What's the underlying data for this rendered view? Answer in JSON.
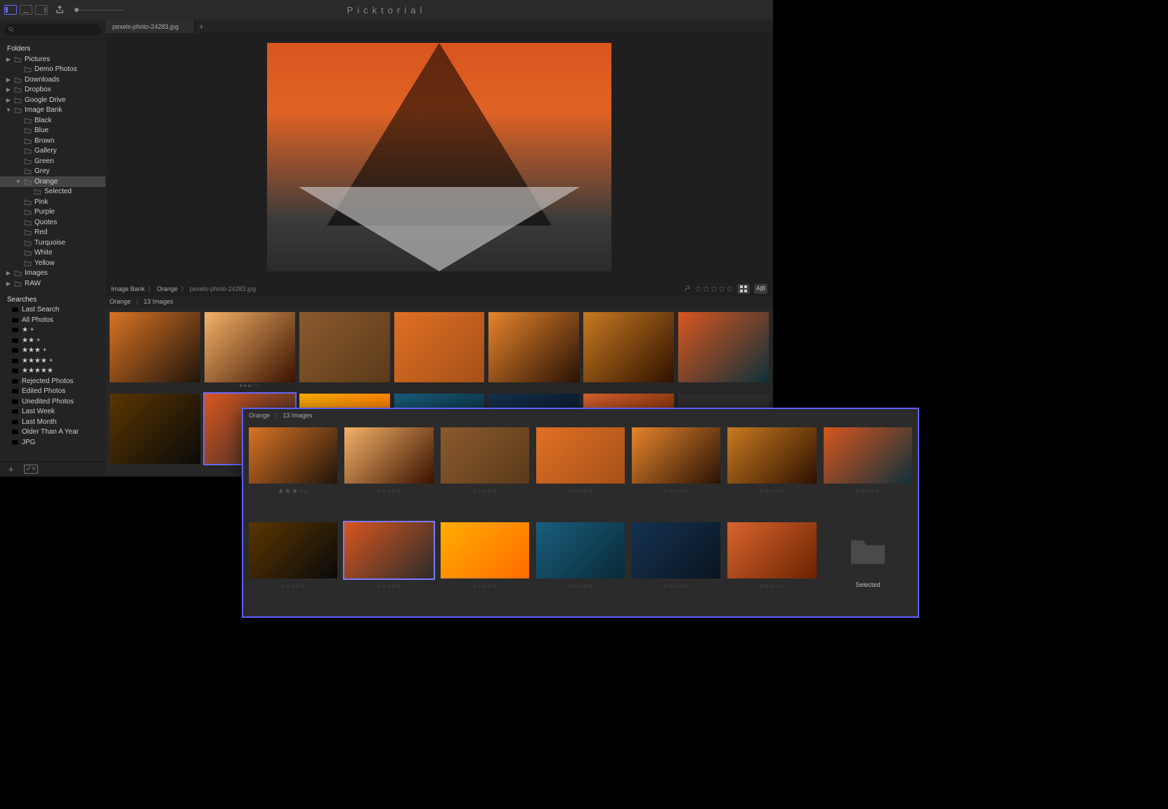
{
  "app_title": "Picktorial",
  "toolbar": {
    "share_label": "share"
  },
  "search": {
    "placeholder": ""
  },
  "sidebar": {
    "sections": {
      "folders": "Folders",
      "searches": "Searches"
    },
    "folders": [
      {
        "label": "Pictures",
        "indent": 0,
        "tri": "closed"
      },
      {
        "label": "Demo Photos",
        "indent": 1,
        "tri": ""
      },
      {
        "label": "Downloads",
        "indent": 0,
        "tri": "closed"
      },
      {
        "label": "Dropbox",
        "indent": 0,
        "tri": "closed"
      },
      {
        "label": "Google Drive",
        "indent": 0,
        "tri": "closed"
      },
      {
        "label": "Image Bank",
        "indent": 0,
        "tri": "open"
      },
      {
        "label": "Black",
        "indent": 1,
        "tri": ""
      },
      {
        "label": "Blue",
        "indent": 1,
        "tri": ""
      },
      {
        "label": "Brown",
        "indent": 1,
        "tri": ""
      },
      {
        "label": "Gallery",
        "indent": 1,
        "tri": ""
      },
      {
        "label": "Green",
        "indent": 1,
        "tri": ""
      },
      {
        "label": "Grey",
        "indent": 1,
        "tri": ""
      },
      {
        "label": "Orange",
        "indent": 1,
        "tri": "open",
        "selected": true
      },
      {
        "label": "Selected",
        "indent": 2,
        "tri": ""
      },
      {
        "label": "Pink",
        "indent": 1,
        "tri": ""
      },
      {
        "label": "Purple",
        "indent": 1,
        "tri": ""
      },
      {
        "label": "Quotes",
        "indent": 1,
        "tri": ""
      },
      {
        "label": "Red",
        "indent": 1,
        "tri": ""
      },
      {
        "label": "Turquoise",
        "indent": 1,
        "tri": ""
      },
      {
        "label": "White",
        "indent": 1,
        "tri": ""
      },
      {
        "label": "Yellow",
        "indent": 1,
        "tri": ""
      },
      {
        "label": "Images",
        "indent": 0,
        "tri": "closed"
      },
      {
        "label": "RAW",
        "indent": 0,
        "tri": "closed"
      }
    ],
    "searches": [
      {
        "label": "Last Search"
      },
      {
        "label": "All Photos"
      },
      {
        "label": "★ +"
      },
      {
        "label": "★★ +"
      },
      {
        "label": "★★★ +"
      },
      {
        "label": "★★★★ +"
      },
      {
        "label": "★★★★★"
      },
      {
        "label": "Rejected Photos"
      },
      {
        "label": "Edited Photos"
      },
      {
        "label": "Unedited Photos"
      },
      {
        "label": "Last Week"
      },
      {
        "label": "Last Month"
      },
      {
        "label": "Older Than A Year"
      },
      {
        "label": "JPG"
      }
    ]
  },
  "tab": {
    "title": "pexels-photo-24283.jpg"
  },
  "breadcrumb": [
    "Image Bank",
    "Orange",
    "pexels-photo-24283.jpg"
  ],
  "crumb_buttons": {
    "grid": "▦",
    "compare": "A|B"
  },
  "grid": {
    "folder_label": "Orange",
    "count_label": "13 Images",
    "thumbs": [
      {
        "rating": "",
        "bg1": "#d97325",
        "bg2": "#20150a"
      },
      {
        "rating": "●●●○○",
        "bg1": "#f5b268",
        "bg2": "#3a1200"
      },
      {
        "rating": "",
        "bg1": "#8a5a2d",
        "bg2": "#5b3a1a"
      },
      {
        "rating": "",
        "bg1": "#e07024",
        "bg2": "#a55018"
      },
      {
        "rating": "",
        "bg1": "#e6852c",
        "bg2": "#2a1205"
      },
      {
        "rating": "",
        "bg1": "#c97a20",
        "bg2": "#2e1100"
      },
      {
        "rating": "",
        "bg1": "#d8561f",
        "bg2": "#10303a"
      },
      {
        "rating": "",
        "bg1": "#5a3500",
        "bg2": "#0a0a0a"
      },
      {
        "rating": "",
        "bg1": "#d8561f",
        "bg2": "#2b2b2b",
        "selected": true
      },
      {
        "rating": "",
        "bg1": "#ffad00",
        "bg2": "#ff6b00"
      },
      {
        "rating": "",
        "bg1": "#195e7d",
        "bg2": "#0a2a38"
      },
      {
        "rating": "",
        "bg1": "#143250",
        "bg2": "#0a1420"
      },
      {
        "rating": "",
        "bg1": "#d9632e",
        "bg2": "#6b2300"
      },
      {
        "folder": true
      }
    ]
  },
  "float": {
    "folder_label": "Orange",
    "count_label": "13 Images",
    "folder_caption": "Selected",
    "thumbs": [
      {
        "rating": "★★★○○",
        "bg1": "#d97325",
        "bg2": "#20150a"
      },
      {
        "rating": "○○○○○",
        "bg1": "#f5b268",
        "bg2": "#3a1200"
      },
      {
        "rating": "○○○○○",
        "bg1": "#8a5a2d",
        "bg2": "#5b3a1a"
      },
      {
        "rating": "○○○○○",
        "bg1": "#e07024",
        "bg2": "#a55018"
      },
      {
        "rating": "○○○○○",
        "bg1": "#e6852c",
        "bg2": "#2a1205"
      },
      {
        "rating": "○○○○○",
        "bg1": "#c97a20",
        "bg2": "#2e1100"
      },
      {
        "rating": "○○○○○",
        "bg1": "#d8561f",
        "bg2": "#10303a"
      },
      {
        "rating": "○○○○○",
        "bg1": "#5a3500",
        "bg2": "#0a0a0a"
      },
      {
        "rating": "○○○○○",
        "bg1": "#d8561f",
        "bg2": "#2b2b2b",
        "selected": true
      },
      {
        "rating": "○○○○○",
        "bg1": "#ffad00",
        "bg2": "#ff6b00"
      },
      {
        "rating": "○○○○○",
        "bg1": "#195e7d",
        "bg2": "#0a2a38"
      },
      {
        "rating": "○○○○○",
        "bg1": "#143250",
        "bg2": "#0a1420"
      },
      {
        "rating": "○○○○○",
        "bg1": "#d9632e",
        "bg2": "#6b2300"
      },
      {
        "folder": true
      }
    ]
  }
}
